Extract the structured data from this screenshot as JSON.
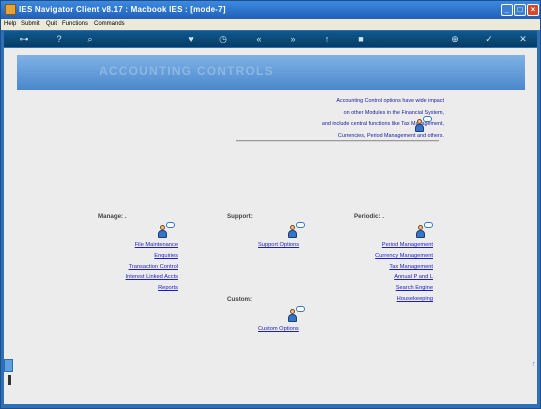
{
  "window": {
    "title": "IES Navigator Client v8.17 : Macbook IES :      [mode-7]"
  },
  "menu": [
    "Help",
    "Submit",
    "Quit",
    "Functions",
    "Commands"
  ],
  "toolbar_icons": [
    "key-icon",
    "help-icon",
    "search-icon",
    "heart-icon",
    "clock-icon",
    "back-icon",
    "forward-icon",
    "up-icon",
    "stop-icon",
    "globe-icon",
    "ok-icon",
    "close-icon"
  ],
  "banner": {
    "title": "ACCOUNTING CONTROLS"
  },
  "intro": [
    "Accounting Control options have wide impact",
    "on other Modules in the Financial System,",
    "and include central functions like Tax Management,",
    "Currencies, Period Management and others."
  ],
  "sections": {
    "manage": {
      "label": "Manage: .",
      "links": [
        "File Maintenance",
        "Enquiries",
        "Transaction Control",
        "Interest Linked Accts",
        "Reports"
      ]
    },
    "support": {
      "label": "Support:",
      "links": [
        "Support Options"
      ]
    },
    "periodic": {
      "label": "Periodic: .",
      "links": [
        "Period Management",
        "Currency Management",
        "Tax Management",
        "Annual P and L",
        "Search Engine",
        "Housekeeping"
      ]
    },
    "custom": {
      "label": "Custom:",
      "links": [
        "Custom Options"
      ]
    }
  },
  "colors": {
    "link": "#1a1ad0",
    "banner": "#5a94d4",
    "toolbar": "#0b4a78"
  }
}
